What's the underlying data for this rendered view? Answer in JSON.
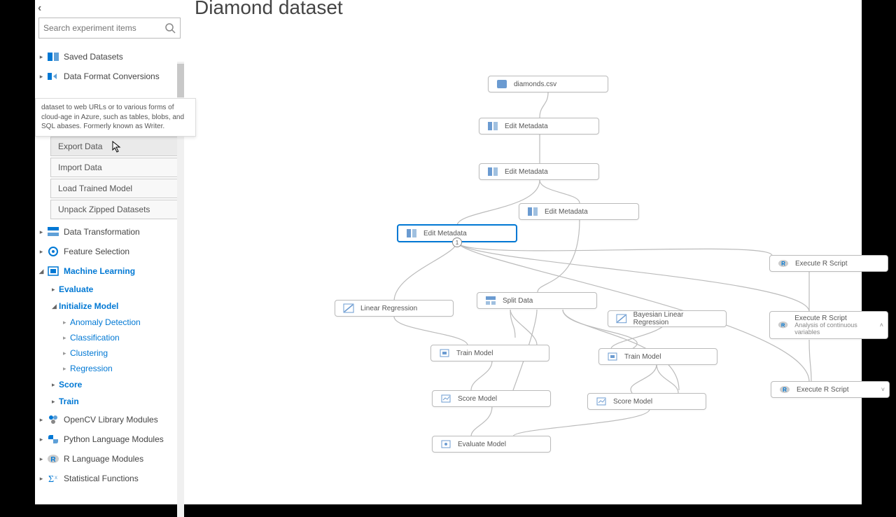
{
  "title": "Diamond dataset",
  "search": {
    "placeholder": "Search experiment items"
  },
  "tooltip": "dataset to web URLs or to various forms of cloud-age in Azure, such as tables, blobs, and SQL abases. Formerly known as Writer.",
  "tree": {
    "saved_datasets": "Saved Datasets",
    "data_format": "Data Format Conversions",
    "io_items": {
      "export_data": "Export Data",
      "import_data": "Import Data",
      "load_trained": "Load Trained Model",
      "unpack_zipped": "Unpack Zipped Datasets"
    },
    "data_transformation": "Data Transformation",
    "feature_selection": "Feature Selection",
    "machine_learning": "Machine Learning",
    "ml_children": {
      "evaluate": "Evaluate",
      "initialize_model": "Initialize Model",
      "init_children": {
        "anomaly": "Anomaly Detection",
        "classification": "Classification",
        "clustering": "Clustering",
        "regression": "Regression"
      },
      "score": "Score",
      "train": "Train"
    },
    "opencv": "OpenCV Library Modules",
    "python": "Python Language Modules",
    "r_lang": "R Language Modules",
    "statistical": "Statistical Functions"
  },
  "nodes": {
    "diamonds": "diamonds.csv",
    "edit_meta": "Edit Metadata",
    "split": "Split Data",
    "linear_reg": "Linear Regression",
    "bayesian": "Bayesian Linear Regression",
    "exec_r": "Execute R Script",
    "exec_r2_sub": "Analysis of continuous variables",
    "train_model": "Train Model",
    "score_model": "Score Model",
    "evaluate_model": "Evaluate Model"
  }
}
